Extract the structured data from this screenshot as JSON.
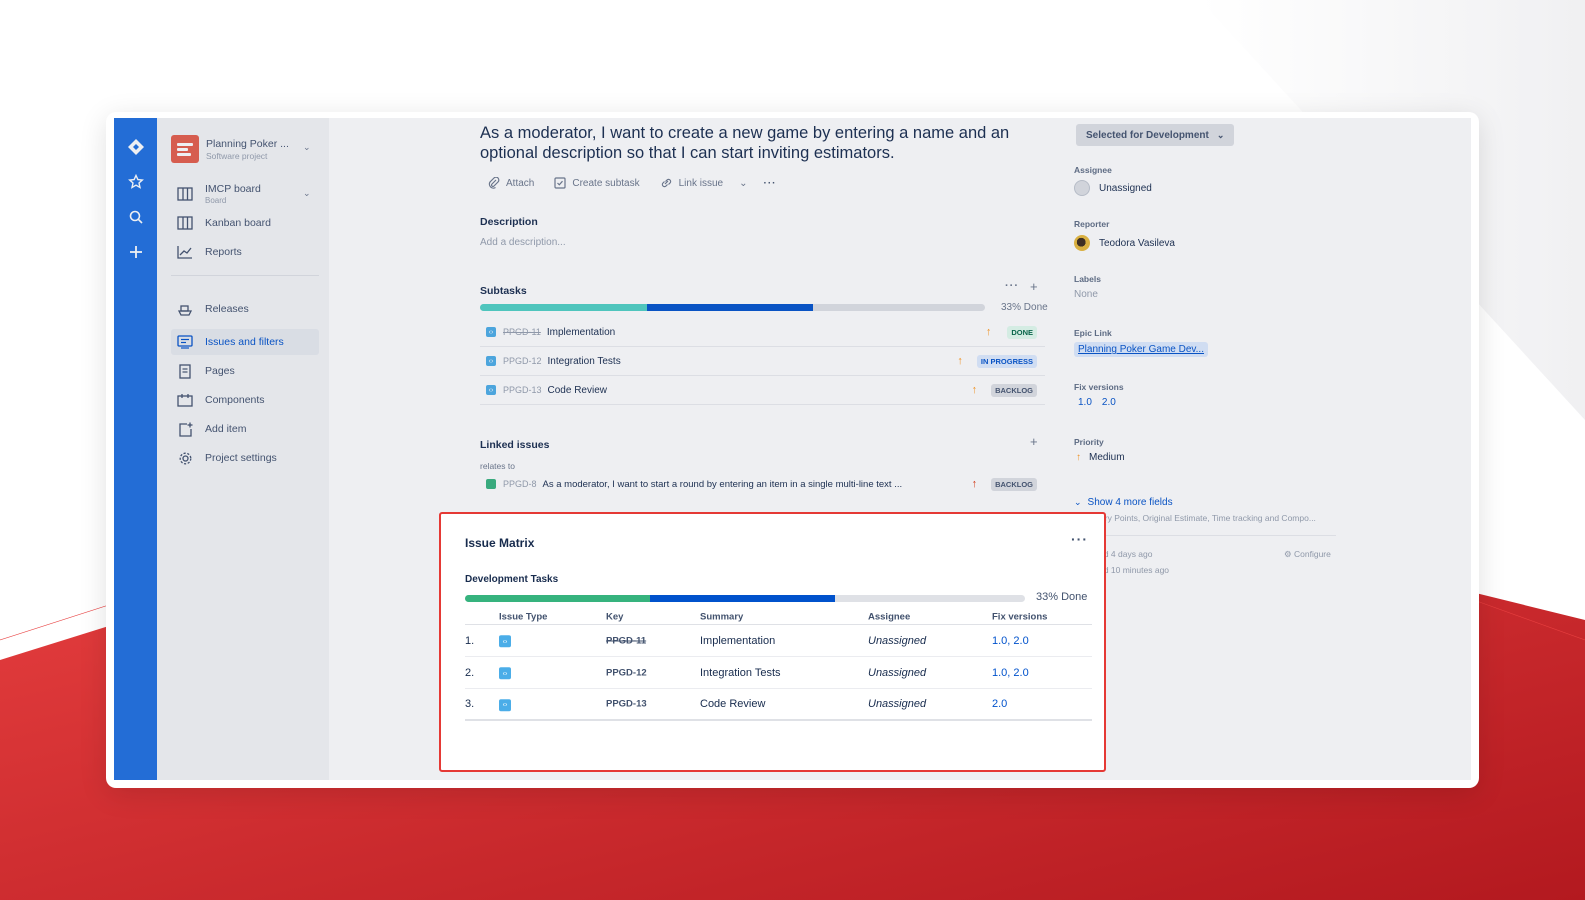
{
  "colors": {
    "brand_blue": "#1d6fe0",
    "accent_red": "#e53935",
    "progress_green": "#36b37e",
    "progress_blue": "#0052cc",
    "progress_teal": "#4fd1c5"
  },
  "sidebar": {
    "project_name": "Planning Poker ...",
    "project_type": "Software project",
    "board_name": "IMCP board",
    "board_type": "Board",
    "items": [
      {
        "label": "Kanban board",
        "icon": "board-icon"
      },
      {
        "label": "Reports",
        "icon": "chart-icon"
      },
      {
        "label": "Releases",
        "icon": "ship-icon"
      },
      {
        "label": "Issues and filters",
        "icon": "filter-icon"
      },
      {
        "label": "Pages",
        "icon": "page-icon"
      },
      {
        "label": "Components",
        "icon": "component-icon"
      },
      {
        "label": "Add item",
        "icon": "add-item-icon"
      },
      {
        "label": "Project settings",
        "icon": "gear-icon"
      }
    ]
  },
  "issue": {
    "title": "As a moderator, I want to create a new game by entering a name and an optional description so that I can start inviting estimators.",
    "toolbar": {
      "attach": "Attach",
      "create_subtask": "Create subtask",
      "link_issue": "Link issue"
    },
    "description_label": "Description",
    "description_placeholder": "Add a description...",
    "subtasks_label": "Subtasks",
    "subtasks_progress_label": "33% Done",
    "subtasks_progress": {
      "done": 0.33,
      "in_progress": 0.33
    },
    "subtasks": [
      {
        "key": "PPGD-11",
        "summary": "Implementation",
        "status": "DONE"
      },
      {
        "key": "PPGD-12",
        "summary": "Integration Tests",
        "status": "IN PROGRESS"
      },
      {
        "key": "PPGD-13",
        "summary": "Code Review",
        "status": "BACKLOG"
      }
    ],
    "linked_label": "Linked issues",
    "relates_to": "relates to",
    "linked": {
      "key": "PPGD-8",
      "summary": "As a moderator, I want to start a round by entering an item in a single multi-line text ...",
      "status": "BACKLOG"
    }
  },
  "details": {
    "status": "Selected for Development",
    "assignee_label": "Assignee",
    "assignee": "Unassigned",
    "reporter_label": "Reporter",
    "reporter": "Teodora Vasileva",
    "labels_label": "Labels",
    "labels": "None",
    "epic_label": "Epic Link",
    "epic": "Planning Poker Game Dev...",
    "fix_label": "Fix versions",
    "fix_versions": [
      "1.0",
      "2.0"
    ],
    "priority_label": "Priority",
    "priority": "Medium",
    "show_more": "Show 4 more fields",
    "show_more_sub": "Story Points, Original Estimate, Time tracking and Compo...",
    "created": "ated 4 days ago",
    "updated": "ated 10 minutes ago",
    "configure": "Configure"
  },
  "matrix": {
    "title": "Issue Matrix",
    "more": "···",
    "subtitle": "Development Tasks",
    "progress_label": "33% Done",
    "progress": {
      "done": 0.33,
      "in_progress": 0.33
    },
    "headers": {
      "type": "Issue Type",
      "key": "Key",
      "summary": "Summary",
      "assignee": "Assignee",
      "fix": "Fix versions"
    },
    "rows": [
      {
        "num": "1.",
        "key": "PPGD-11",
        "summary": "Implementation",
        "assignee": "Unassigned",
        "fix": "1.0, 2.0"
      },
      {
        "num": "2.",
        "key": "PPGD-12",
        "summary": "Integration Tests",
        "assignee": "Unassigned",
        "fix": "1.0, 2.0"
      },
      {
        "num": "3.",
        "key": "PPGD-13",
        "summary": "Code Review",
        "assignee": "Unassigned",
        "fix": "2.0"
      }
    ]
  }
}
